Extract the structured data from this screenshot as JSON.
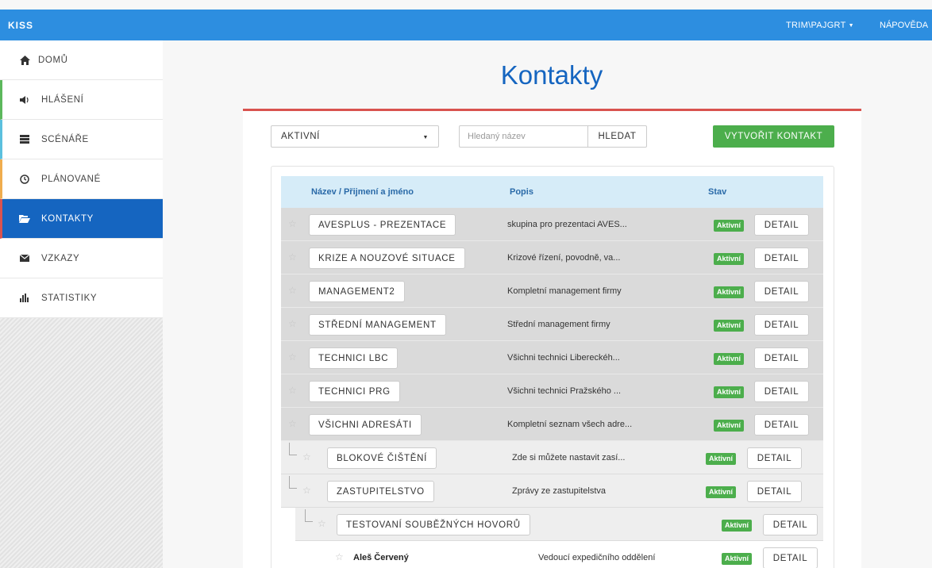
{
  "app": {
    "brand": "KISS",
    "user_menu": "TRIM\\PAJGRT",
    "help": "NÁPOVĚDA"
  },
  "sidebar": {
    "items": [
      {
        "label": "DOMŮ",
        "icon": "home-icon"
      },
      {
        "label": "HLÁŠENÍ",
        "icon": "volume-icon"
      },
      {
        "label": "SCÉNÁŘE",
        "icon": "tasks-icon"
      },
      {
        "label": "PLÁNOVANÉ",
        "icon": "clock-icon"
      },
      {
        "label": "KONTAKTY",
        "icon": "folder-open-icon"
      },
      {
        "label": "VZKAZY",
        "icon": "envelope-icon"
      },
      {
        "label": "STATISTIKY",
        "icon": "bar-chart-icon"
      }
    ]
  },
  "page": {
    "title": "Kontakty"
  },
  "toolbar": {
    "status_value": "AKTIVNÍ",
    "search_placeholder": "Hledaný název",
    "search_label": "HLEDAT",
    "create_label": "VYTVOŘIT KONTAKT"
  },
  "table": {
    "headers": {
      "name": "Název / Přijmení a jméno",
      "description": "Popis",
      "status": "Stav"
    },
    "rows": [
      {
        "name": "AVESPLUS - PREZENTACE",
        "description": "skupina pro prezentaci AVES...",
        "status": "Aktivní",
        "detail": "DETAIL"
      },
      {
        "name": "KRIZE A NOUZOVÉ SITUACE",
        "description": "Krizové řízení, povodně, va...",
        "status": "Aktivní",
        "detail": "DETAIL"
      },
      {
        "name": "MANAGEMENT2",
        "description": "Kompletní management firmy",
        "status": "Aktivní",
        "detail": "DETAIL"
      },
      {
        "name": "STŘEDNÍ MANAGEMENT",
        "description": "Střední management firmy",
        "status": "Aktivní",
        "detail": "DETAIL"
      },
      {
        "name": "TECHNICI LBC",
        "description": "Všichni technici Libereckéh...",
        "status": "Aktivní",
        "detail": "DETAIL"
      },
      {
        "name": "TECHNICI PRG",
        "description": "Všichni technici Pražského ...",
        "status": "Aktivní",
        "detail": "DETAIL"
      },
      {
        "name": "VŠICHNI ADRESÁTI",
        "description": "Kompletní seznam všech adre...",
        "status": "Aktivní",
        "detail": "DETAIL"
      },
      {
        "name": "BLOKOVÉ ČIŠTĚNÍ",
        "description": "Zde si můžete nastavit zasí...",
        "status": "Aktivní",
        "detail": "DETAIL"
      },
      {
        "name": "ZASTUPITELSTVO",
        "description": "Zprávy ze zastupitelstva",
        "status": "Aktivní",
        "detail": "DETAIL"
      },
      {
        "name": "TESTOVANÍ SOUBĚŽNÝCH HOVORŮ",
        "description": "",
        "status": "Aktivní",
        "detail": "DETAIL"
      },
      {
        "name": "Aleš Červený",
        "description": "Vedoucí expedičního oddělení",
        "status": "Aktivní",
        "detail": "DETAIL"
      }
    ]
  }
}
